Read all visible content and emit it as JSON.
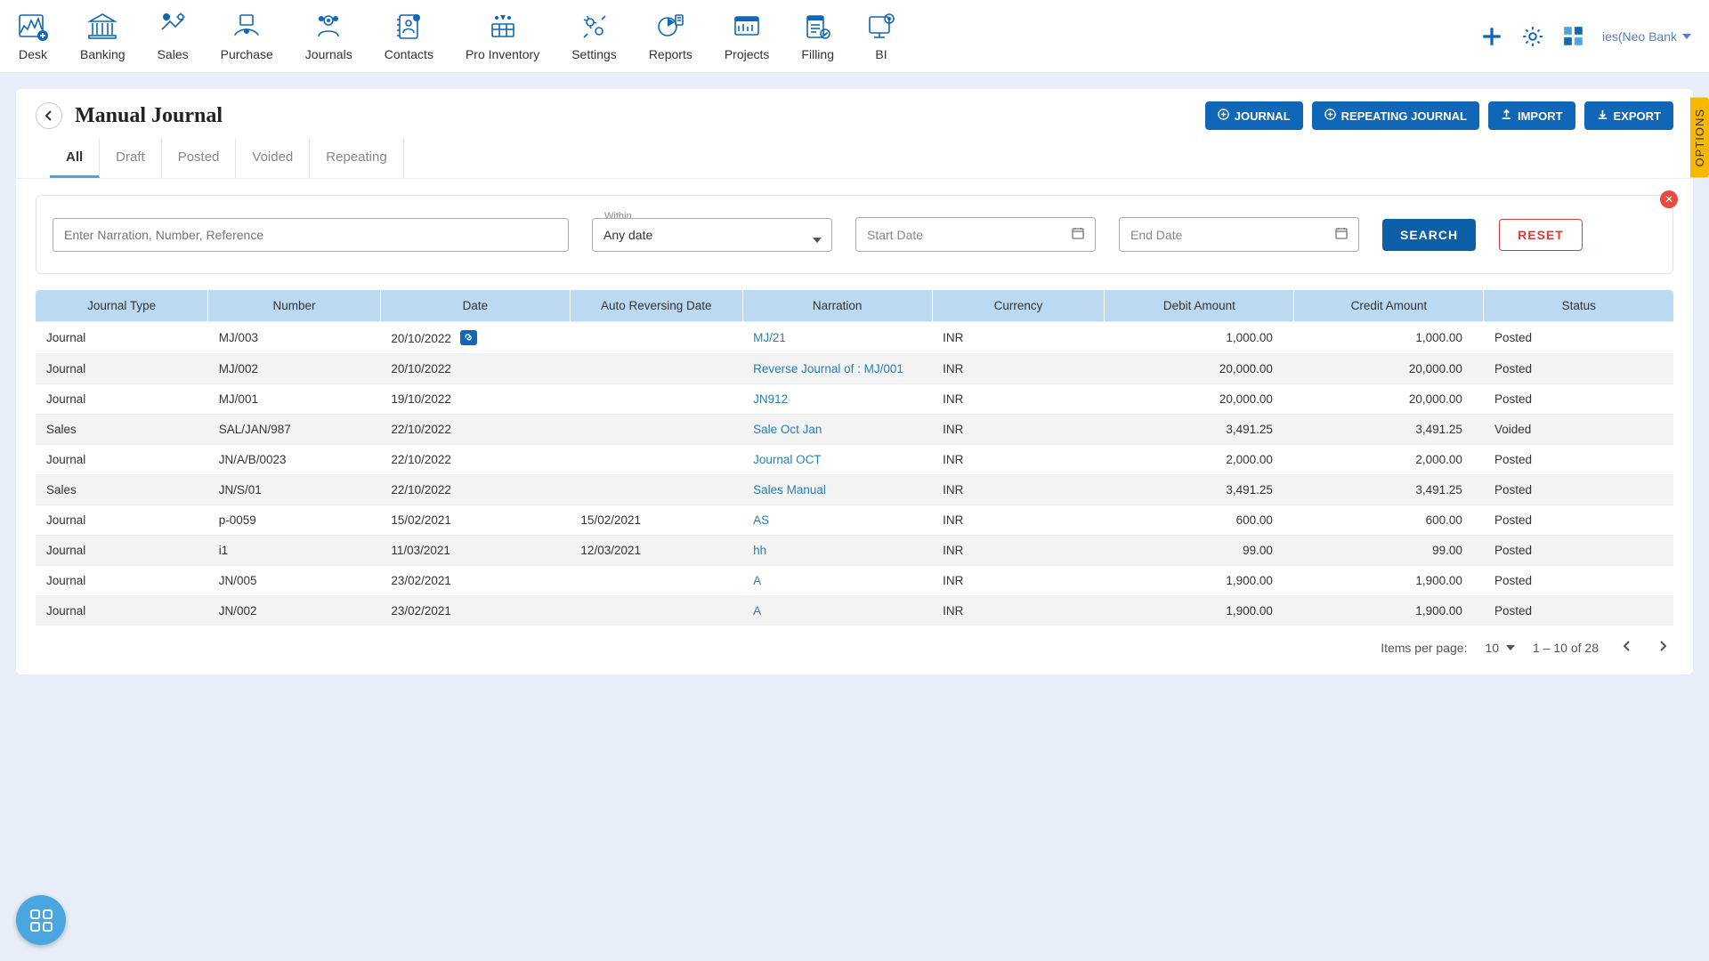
{
  "nav": {
    "items": [
      {
        "label": "Desk"
      },
      {
        "label": "Banking"
      },
      {
        "label": "Sales"
      },
      {
        "label": "Purchase"
      },
      {
        "label": "Journals"
      },
      {
        "label": "Contacts"
      },
      {
        "label": "Pro Inventory"
      },
      {
        "label": "Settings"
      },
      {
        "label": "Reports"
      },
      {
        "label": "Projects"
      },
      {
        "label": "Filling"
      },
      {
        "label": "BI"
      }
    ],
    "company": "ies(Neo Bank"
  },
  "page": {
    "title": "Manual Journal",
    "actions": {
      "journal": "JOURNAL",
      "repeating": "REPEATING JOURNAL",
      "import": "IMPORT",
      "export": "EXPORT"
    }
  },
  "tabs": [
    "All",
    "Draft",
    "Posted",
    "Voided",
    "Repeating"
  ],
  "activeTab": 0,
  "filter": {
    "searchPlaceholder": "Enter Narration, Number, Reference",
    "withinLabel": "Within",
    "withinValue": "Any date",
    "startPlaceholder": "Start Date",
    "endPlaceholder": "End Date",
    "searchBtn": "SEARCH",
    "resetBtn": "RESET"
  },
  "table": {
    "columns": [
      "Journal Type",
      "Number",
      "Date",
      "Auto Reversing Date",
      "Narration",
      "Currency",
      "Debit Amount",
      "Credit Amount",
      "Status"
    ],
    "rows": [
      {
        "type": "Journal",
        "number": "MJ/003",
        "date": "20/10/2022",
        "ard": "",
        "narration": "MJ/21",
        "currency": "INR",
        "debit": "1,000.00",
        "credit": "1,000.00",
        "status": "Posted",
        "linkbadge": true
      },
      {
        "type": "Journal",
        "number": "MJ/002",
        "date": "20/10/2022",
        "ard": "",
        "narration": "Reverse Journal of : MJ/001",
        "currency": "INR",
        "debit": "20,000.00",
        "credit": "20,000.00",
        "status": "Posted"
      },
      {
        "type": "Journal",
        "number": "MJ/001",
        "date": "19/10/2022",
        "ard": "",
        "narration": "JN912",
        "currency": "INR",
        "debit": "20,000.00",
        "credit": "20,000.00",
        "status": "Posted"
      },
      {
        "type": "Sales",
        "number": "SAL/JAN/987",
        "date": "22/10/2022",
        "ard": "",
        "narration": "Sale Oct Jan",
        "currency": "INR",
        "debit": "3,491.25",
        "credit": "3,491.25",
        "status": "Voided"
      },
      {
        "type": "Journal",
        "number": "JN/A/B/0023",
        "date": "22/10/2022",
        "ard": "",
        "narration": "Journal OCT",
        "currency": "INR",
        "debit": "2,000.00",
        "credit": "2,000.00",
        "status": "Posted"
      },
      {
        "type": "Sales",
        "number": "JN/S/01",
        "date": "22/10/2022",
        "ard": "",
        "narration": "Sales Manual",
        "currency": "INR",
        "debit": "3,491.25",
        "credit": "3,491.25",
        "status": "Posted"
      },
      {
        "type": "Journal",
        "number": "p-0059",
        "date": "15/02/2021",
        "ard": "15/02/2021",
        "narration": "AS",
        "currency": "INR",
        "debit": "600.00",
        "credit": "600.00",
        "status": "Posted"
      },
      {
        "type": "Journal",
        "number": "i1",
        "date": "11/03/2021",
        "ard": "12/03/2021",
        "narration": "hh",
        "currency": "INR",
        "debit": "99.00",
        "credit": "99.00",
        "status": "Posted"
      },
      {
        "type": "Journal",
        "number": "JN/005",
        "date": "23/02/2021",
        "ard": "",
        "narration": "A",
        "currency": "INR",
        "debit": "1,900.00",
        "credit": "1,900.00",
        "status": "Posted"
      },
      {
        "type": "Journal",
        "number": "JN/002",
        "date": "23/02/2021",
        "ard": "",
        "narration": "A",
        "currency": "INR",
        "debit": "1,900.00",
        "credit": "1,900.00",
        "status": "Posted"
      }
    ]
  },
  "paginator": {
    "itemsPerPageLabel": "Items per page:",
    "pageSize": "10",
    "range": "1 – 10 of 28"
  },
  "optionsTab": "OPTIONS"
}
